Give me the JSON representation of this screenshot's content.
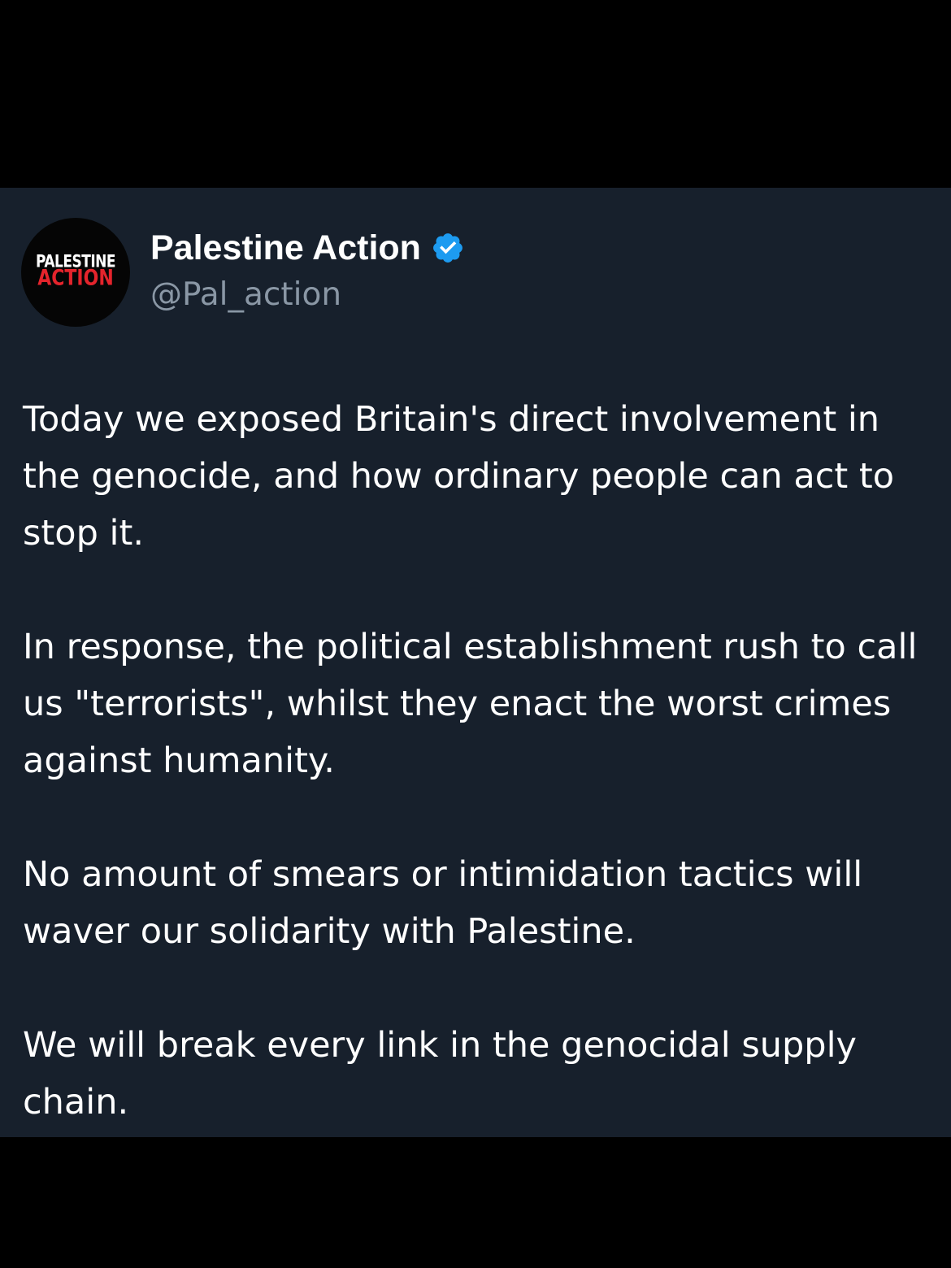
{
  "tweet": {
    "avatar": {
      "line1": "PALESTINE",
      "line2": "ACTION"
    },
    "author": {
      "display_name": "Palestine Action",
      "handle": "@Pal_action",
      "verified_icon": "verified-badge-icon"
    },
    "paragraphs": [
      "Today we exposed Britain's direct involvement in the genocide, and how ordinary people can act to stop it.",
      "In response, the political establishment rush to call us \"terrorists\", whilst they enact the worst crimes against humanity.",
      "No amount of smears or intimidation tactics will waver our solidarity with Palestine.",
      "We will break every link in the genocidal supply chain."
    ]
  },
  "colors": {
    "page_background": "#000000",
    "card_background": "#17202c",
    "text_primary": "#ffffff",
    "text_secondary": "#8a97a5",
    "verified_blue": "#1d9bf0",
    "logo_red": "#e4242c"
  }
}
